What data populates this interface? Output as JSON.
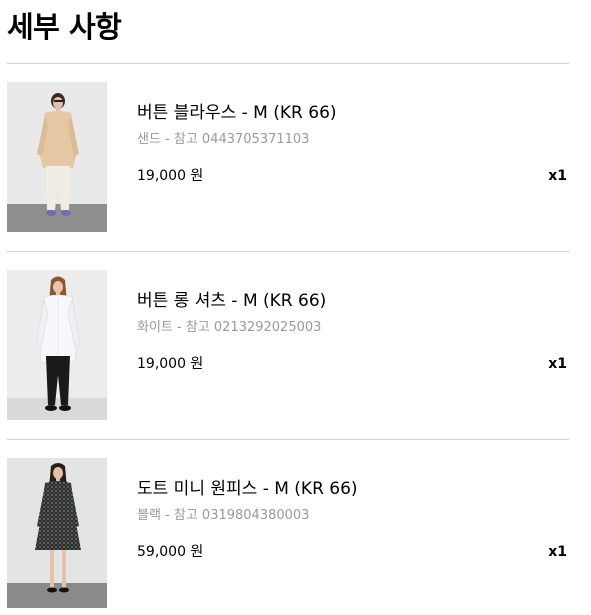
{
  "section": {
    "title": "세부 사항"
  },
  "items": [
    {
      "name": "버튼 블라우스 - M (KR 66)",
      "ref": "샌드 - 참고 0443705371103",
      "price": "19,000 원",
      "qty": "x1",
      "image": "woman-in-sand-blouse-and-white-pants"
    },
    {
      "name": "버튼 롱 셔츠 - M (KR 66)",
      "ref": "화이트 - 참고 0213292025003",
      "price": "19,000 원",
      "qty": "x1",
      "image": "woman-in-white-long-shirt-and-black-pants"
    },
    {
      "name": "도트 미니 원피스 - M (KR 66)",
      "ref": "블랙 - 참고 0319804380003",
      "price": "59,000 원",
      "qty": "x1",
      "image": "woman-in-black-dot-mini-dress"
    }
  ]
}
